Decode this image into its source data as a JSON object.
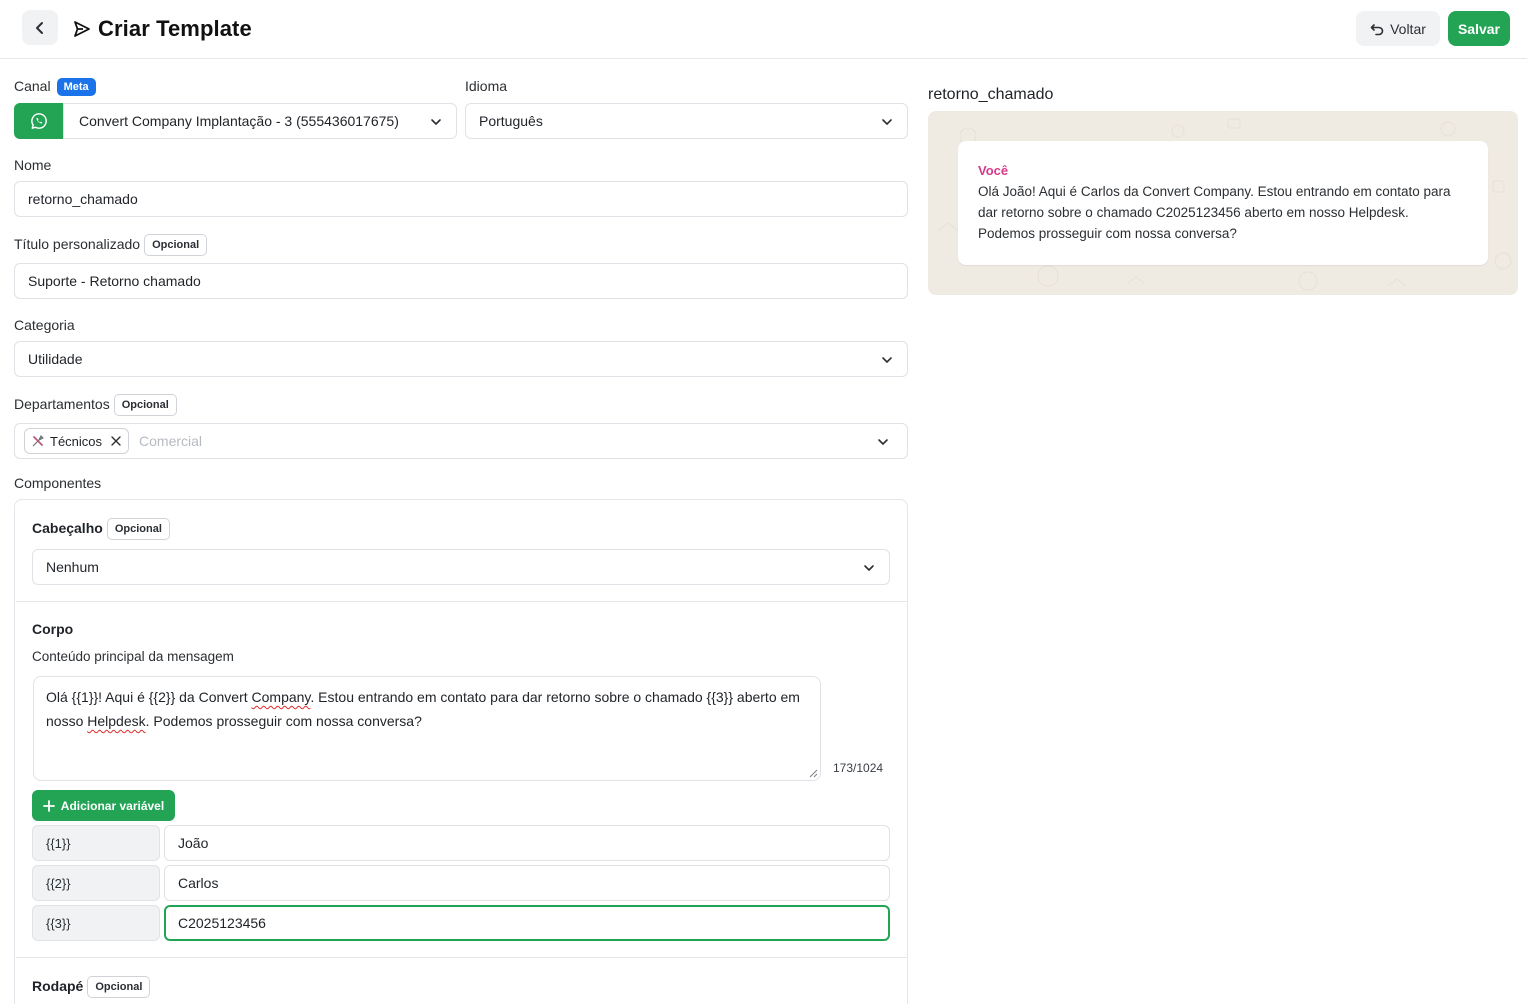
{
  "header": {
    "title": "Criar Template",
    "back_label": "Voltar",
    "save_label": "Salvar"
  },
  "form": {
    "canal": {
      "label": "Canal",
      "badge": "Meta",
      "value": "Convert Company Implantação - 3 (555436017675)"
    },
    "idioma": {
      "label": "Idioma",
      "value": "Português"
    },
    "nome": {
      "label": "Nome",
      "value": "retorno_chamado"
    },
    "titulo": {
      "label": "Título personalizado",
      "badge": "Opcional",
      "value": "Suporte - Retorno chamado"
    },
    "categoria": {
      "label": "Categoria",
      "value": "Utilidade"
    },
    "departamentos": {
      "label": "Departamentos",
      "badge": "Opcional",
      "selected": [
        "Técnicos"
      ],
      "placeholder": "Comercial"
    },
    "componentes": {
      "label": "Componentes",
      "cabecalho": {
        "label": "Cabeçalho",
        "badge": "Opcional",
        "value": "Nenhum"
      },
      "corpo": {
        "label": "Corpo",
        "description": "Conteúdo principal da mensagem",
        "text_part1": "Olá {{1}}! Aqui é {{2}} da Convert ",
        "text_misspelled1": "Company",
        "text_part2": ". Estou entrando em contato para dar retorno sobre o chamado {{3}} aberto em nosso ",
        "text_misspelled2": "Helpdesk",
        "text_part3": ". Podemos prosseguir com nossa conversa?",
        "counter": "173/1024",
        "add_variable_label": "Adicionar variável",
        "variables": [
          {
            "key": "{{1}}",
            "value": "João"
          },
          {
            "key": "{{2}}",
            "value": "Carlos"
          },
          {
            "key": "{{3}}",
            "value": "C2025123456"
          }
        ]
      },
      "rodape": {
        "label": "Rodapé",
        "badge": "Opcional"
      }
    }
  },
  "preview": {
    "title": "retorno_chamado",
    "author": "Você",
    "message": "Olá João! Aqui é Carlos da Convert Company. Estou entrando em contato para dar retorno sobre o chamado C2025123456 aberto em nosso Helpdesk. Podemos prosseguir com nossa conversa?"
  },
  "colors": {
    "primary_green": "#22a454",
    "meta_blue": "#1a73e8",
    "author_pink": "#d63a8a",
    "preview_bg": "#efeae2"
  },
  "icons": [
    "chevron-left-icon",
    "send-icon",
    "undo-icon",
    "whatsapp-icon",
    "chevron-down-icon",
    "tools-icon",
    "close-icon",
    "plus-icon"
  ]
}
